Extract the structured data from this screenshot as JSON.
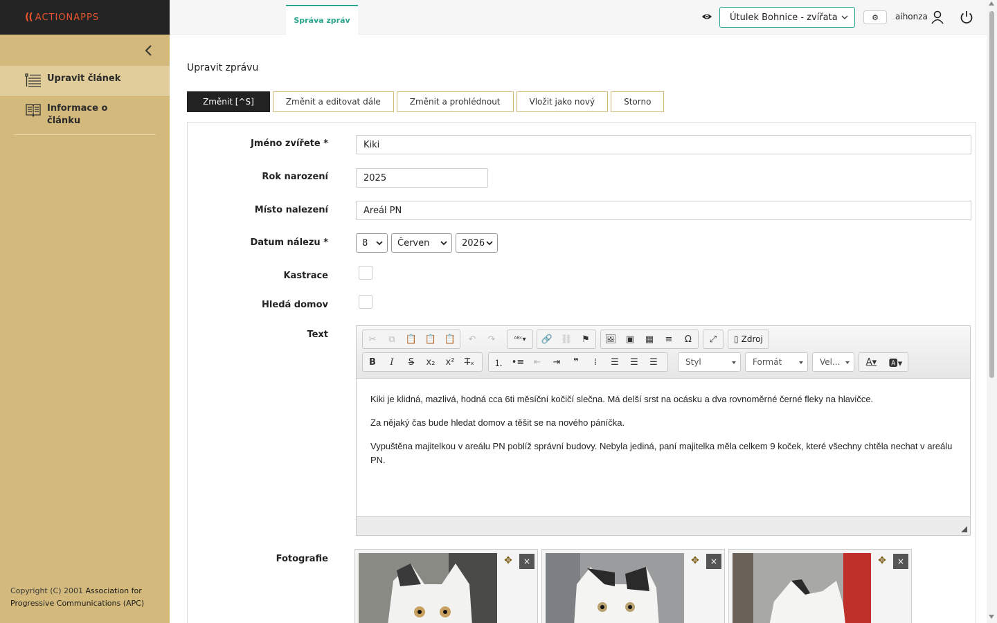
{
  "brand": {
    "mark": "((",
    "name": "ACTIONAPPS"
  },
  "sidebar": {
    "items": [
      {
        "label": "Upravit článek",
        "icon": "list-icon"
      },
      {
        "label": "Informace o článku",
        "icon": "book-icon"
      }
    ],
    "copyright_prefix": "Copyright (C) 2001 ",
    "copyright_link": "Association for Progressive Communications (APC)"
  },
  "topbar": {
    "tab": "Správa zpráv",
    "site": "Útulek Bohnice - zvířata",
    "settings": "⚙",
    "user": "aihonza"
  },
  "page": {
    "title": "Upravit zprávu",
    "actions": [
      "Změnit [^S]",
      "Změnit a editovat dále",
      "Změnit a prohlédnout",
      "Vložit jako nový",
      "Storno"
    ]
  },
  "form": {
    "name_label": "Jméno zvířete *",
    "name_value": "Kiki",
    "year_label": "Rok narození",
    "year_value": "2025",
    "place_label": "Místo nalezení",
    "place_value": "Areál PN",
    "date_label": "Datum nálezu *",
    "date_day": "8",
    "date_month": "Červen",
    "date_year": "2026",
    "castration_label": "Kastrace",
    "castration_checked": false,
    "home_label": "Hledá domov",
    "home_checked": false,
    "text_label": "Text",
    "photos_label": "Fotografie"
  },
  "editor": {
    "source_label": "Zdroj",
    "style_label": "Styl",
    "format_label": "Formát",
    "size_label": "Vel...",
    "paragraphs": [
      "Kiki je klidná, mazlivá, hodná cca 6ti měsíční kočičí slečna. Má delší srst na ocásku a dva rovnoměrné černé fleky na hlavičce.",
      "Za nějaký čas bude hledat domov a těšit se na nového páníčka.",
      "Vypuštěna majitelkou v areálu PN poblíž správní budovy. Nebyla jediná, paní majitelka měla celkem 9 koček, které všechny chtěla nechat v areálu PN."
    ]
  },
  "photos": {
    "remove": "×",
    "move": "✥"
  }
}
